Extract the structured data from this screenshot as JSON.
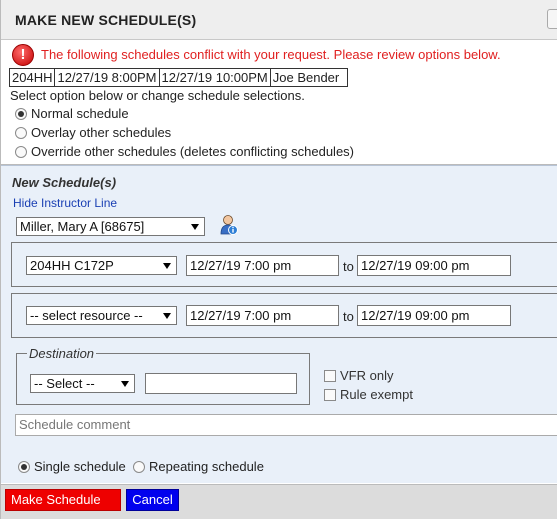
{
  "dialog": {
    "title": "MAKE NEW SCHEDULE(S)"
  },
  "conflict": {
    "message": "The following schedules conflict with your request. Please review options below.",
    "row": [
      "204HH",
      "12/27/19 8:00PM",
      "12/27/19 10:00PM",
      "Joe Bender"
    ],
    "instruction": "Select option below or change schedule selections.",
    "options": [
      {
        "label": "Normal schedule",
        "selected": true
      },
      {
        "label": "Overlay other schedules",
        "selected": false
      },
      {
        "label": "Override other schedules (deletes conflicting schedules)",
        "selected": false
      }
    ]
  },
  "new_schedule": {
    "heading": "New Schedule(s)",
    "hide_instructor_link": "Hide Instructor Line",
    "instructor": "Miller, Mary A [68675]",
    "instructor_icon": "user-info-icon",
    "line1": {
      "resource": "204HH C172P",
      "start": "12/27/19 7:00 pm",
      "to": "to",
      "end": "12/27/19 09:00 pm"
    },
    "line2": {
      "resource": "-- select resource --",
      "start": "12/27/19 7:00 pm",
      "to": "to",
      "end": "12/27/19 09:00 pm"
    },
    "destination": {
      "legend": "Destination",
      "select": "-- Select --",
      "text": ""
    },
    "vfr_only": "VFR only",
    "rule_exempt": "Rule exempt",
    "comment_placeholder": "Schedule comment",
    "schedule_types": [
      {
        "label": "Single schedule",
        "selected": true
      },
      {
        "label": "Repeating schedule",
        "selected": false
      }
    ]
  },
  "buttons": {
    "make": "Make Schedule",
    "cancel": "Cancel"
  },
  "colors": {
    "error": "#e02020",
    "panel_bg": "#e9f0f9",
    "make_button": "#ee0000",
    "cancel_button": "#0000ee",
    "link": "#1a3fb3"
  }
}
